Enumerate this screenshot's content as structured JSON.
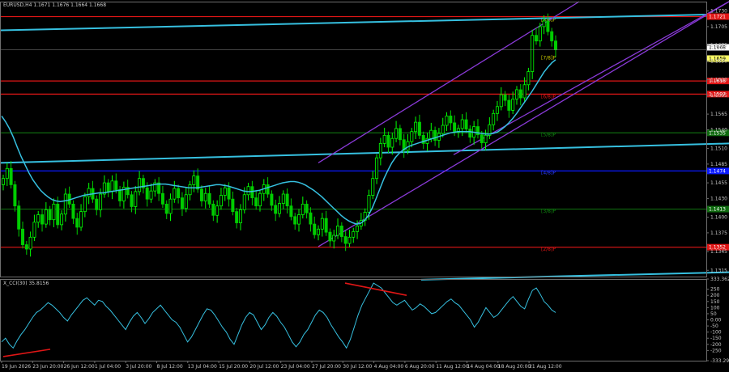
{
  "header": {
    "symbol_line": "EURUSD,H4  1.1671 1.1676 1.1664 1.1668",
    "indicator_line": "X_CCI(30) 35.8156"
  },
  "colors": {
    "background": "#000000",
    "frame": "#6f6f6f",
    "candle_up": "#00ff00",
    "candle_down": "#00cc00",
    "ma": "#36c0e0",
    "trendline": "#36c0e0",
    "channel": "#8a3ad8",
    "res_red": "#e01616",
    "sup_blue": "#0a1aff",
    "green_level": "#0f6a0f",
    "cci_line": "#36c0e0",
    "divergence": "#e01616"
  },
  "chart_data": [
    {
      "type": "candlestick",
      "panel": "price",
      "symbol": "EURUSD",
      "timeframe": "H4",
      "y_axis": {
        "range": [
          1.1305,
          1.1745
        ],
        "tick_labels": [
          "1.1730",
          "1.1705",
          "1.1675",
          "1.1650",
          "1.1620",
          "1.1595",
          "1.1565",
          "1.1540",
          "1.1510",
          "1.1485",
          "1.1455",
          "1.1430",
          "1.1400",
          "1.1375",
          "1.1345",
          "1.1315"
        ]
      },
      "x_axis": {
        "tick_labels": [
          "19 Jun 2026",
          "23 Jun 20:00",
          "26 Jun 12:00",
          "1 Jul 04:00",
          "3 Jul 20:00",
          "8 Jul 12:00",
          "13 Jul 04:00",
          "15 Jul 20:00",
          "20 Jul 12:00",
          "23 Jul 04:00",
          "27 Jul 20:00",
          "30 Jul 12:00",
          "4 Aug 04:00",
          "6 Aug 20:00",
          "11 Aug 12:00",
          "14 Aug 04:00",
          "18 Aug 20:00",
          "21 Aug 12:00"
        ]
      },
      "current_price": {
        "label": "1.1668",
        "value": 1.1668
      },
      "price_labels": [
        {
          "label": "1.1668",
          "value": 1.1668,
          "color": "#ffffff"
        },
        {
          "label": "1.1659",
          "value": 1.1659,
          "color": "#ffff66"
        }
      ],
      "horizontal_levels": [
        {
          "value": 1.1721,
          "label": "1.1721",
          "color": "#e01616"
        },
        {
          "value": 1.1618,
          "label": "1.1618",
          "color": "#e01616"
        },
        {
          "value": 1.1597,
          "label": "1.1597",
          "color": "#e01616"
        },
        {
          "value": 1.1535,
          "label": "1.1535",
          "color": "#0f6a0f"
        },
        {
          "value": 1.1474,
          "label": "1.1474",
          "color": "#0a1aff"
        },
        {
          "value": 1.1413,
          "label": "1.1413",
          "color": "#0f6a0f"
        },
        {
          "value": 1.1352,
          "label": "1.1352",
          "color": "#e01616"
        }
      ],
      "murray_labels": [
        {
          "text": "[8/8]P",
          "value": 1.1716,
          "color": "#c9c900"
        },
        {
          "text": "[7/8]P",
          "value": 1.1655,
          "color": "#c9c900"
        },
        {
          "text": "[6/8]P",
          "value": 1.1593,
          "color": "#e01616"
        },
        {
          "text": "[5/8]P",
          "value": 1.1532,
          "color": "#0f8a0f"
        },
        {
          "text": "[4/8]P",
          "value": 1.1471,
          "color": "#2a3aff"
        },
        {
          "text": "[3/8]P",
          "value": 1.141,
          "color": "#0f8a0f"
        },
        {
          "text": "[2/8]P",
          "value": 1.1349,
          "color": "#e01616"
        }
      ],
      "trendlines": [
        {
          "from": [
            0,
            1.1699
          ],
          "to": [
            900,
            1.1725
          ],
          "color": "#36c0e0"
        },
        {
          "from": [
            0,
            1.1487
          ],
          "to": [
            900,
            1.1518
          ],
          "color": "#36c0e0"
        },
        {
          "from": [
            520,
            1.13
          ],
          "to": [
            900,
            1.1312
          ],
          "color": "#36c0e0"
        }
      ],
      "channel": [
        {
          "from": [
            393,
            1.1487
          ],
          "to": [
            715,
            1.1745
          ],
          "color": "#8a3ad8"
        },
        {
          "from": [
            393,
            1.1353
          ],
          "to": [
            900,
            1.1745
          ],
          "color": "#8a3ad8"
        },
        {
          "from": [
            560,
            1.15
          ],
          "to": [
            900,
            1.1745
          ],
          "color": "#8a3ad8"
        }
      ],
      "ma_series": [
        1.1562,
        1.1553,
        1.1542,
        1.1528,
        1.1512,
        1.1497,
        1.1484,
        1.1471,
        1.146,
        1.1451,
        1.1443,
        1.1437,
        1.1432,
        1.1428,
        1.1426,
        1.1425,
        1.1426,
        1.1427,
        1.1429,
        1.1431,
        1.1433,
        1.1435,
        1.1436,
        1.1437,
        1.1438,
        1.1439,
        1.1439,
        1.144,
        1.1441,
        1.1442,
        1.1443,
        1.1444,
        1.1445,
        1.1446,
        1.1447,
        1.1448,
        1.1449,
        1.145,
        1.1451,
        1.1452,
        1.1453,
        1.1453,
        1.1453,
        1.1452,
        1.1451,
        1.145,
        1.1449,
        1.1448,
        1.1447,
        1.1447,
        1.1447,
        1.1448,
        1.1449,
        1.145,
        1.1451,
        1.1452,
        1.1452,
        1.1451,
        1.145,
        1.1448,
        1.1446,
        1.1444,
        1.1442,
        1.1441,
        1.1441,
        1.1442,
        1.1443,
        1.1445,
        1.1447,
        1.1449,
        1.1451,
        1.1453,
        1.1455,
        1.1456,
        1.1457,
        1.1457,
        1.1456,
        1.1454,
        1.1451,
        1.1447,
        1.1443,
        1.1438,
        1.1433,
        1.1427,
        1.1421,
        1.1415,
        1.1409,
        1.1403,
        1.1398,
        1.1394,
        1.1391,
        1.1389,
        1.139,
        1.1395,
        1.1403,
        1.1415,
        1.143,
        1.1446,
        1.1462,
        1.1475,
        1.1487,
        1.1496,
        1.1503,
        1.1508,
        1.1512,
        1.1515,
        1.1517,
        1.1519,
        1.1521,
        1.1523,
        1.1525,
        1.1527,
        1.1529,
        1.1531,
        1.1533,
        1.1535,
        1.1536,
        1.1537,
        1.1537,
        1.1537,
        1.1537,
        1.1536,
        1.1535,
        1.1534,
        1.1533,
        1.1533,
        1.1534,
        1.1536,
        1.154,
        1.1545,
        1.1551,
        1.1558,
        1.1566,
        1.1575,
        1.1584,
        1.1593,
        1.1602,
        1.1612,
        1.1622,
        1.1632,
        1.164,
        1.1647,
        1.1652
      ],
      "candle_closes": [
        1.1462,
        1.1478,
        1.1452,
        1.1418,
        1.1381,
        1.1356,
        1.1349,
        1.1368,
        1.1392,
        1.1404,
        1.1389,
        1.1412,
        1.1396,
        1.1421,
        1.1388,
        1.1405,
        1.1437,
        1.1421,
        1.1398,
        1.1384,
        1.1409,
        1.1433,
        1.1446,
        1.1429,
        1.1412,
        1.1437,
        1.1455,
        1.1441,
        1.1458,
        1.1444,
        1.1426,
        1.1448,
        1.1436,
        1.1417,
        1.1441,
        1.1462,
        1.1447,
        1.1429,
        1.1442,
        1.1455,
        1.1438,
        1.1421,
        1.1406,
        1.1429,
        1.1446,
        1.1431,
        1.1414,
        1.1436,
        1.1452,
        1.1466,
        1.1445,
        1.1426,
        1.1438,
        1.1421,
        1.1403,
        1.1418,
        1.1435,
        1.1447,
        1.1429,
        1.1409,
        1.1391,
        1.1412,
        1.1436,
        1.1449,
        1.1431,
        1.1418,
        1.1438,
        1.1452,
        1.1437,
        1.1419,
        1.1406,
        1.1422,
        1.1437,
        1.1418,
        1.1401,
        1.1389,
        1.1404,
        1.1421,
        1.1407,
        1.1389,
        1.1372,
        1.1381,
        1.1398,
        1.1376,
        1.1362,
        1.1371,
        1.1386,
        1.1369,
        1.1358,
        1.1368,
        1.1377,
        1.1386,
        1.1395,
        1.1408,
        1.1435,
        1.1462,
        1.1495,
        1.1518,
        1.1531,
        1.1512,
        1.1526,
        1.1542,
        1.1524,
        1.1507,
        1.1521,
        1.1537,
        1.1552,
        1.1531,
        1.1518,
        1.1526,
        1.1539,
        1.1523,
        1.1534,
        1.1547,
        1.1562,
        1.1551,
        1.1536,
        1.1542,
        1.1556,
        1.1541,
        1.1528,
        1.1545,
        1.1532,
        1.1519,
        1.1531,
        1.1548,
        1.1566,
        1.1577,
        1.1596,
        1.1587,
        1.1571,
        1.1589,
        1.1604,
        1.1591,
        1.1612,
        1.1633,
        1.1691,
        1.1682,
        1.1705,
        1.1714,
        1.1697,
        1.1682,
        1.1668
      ]
    },
    {
      "type": "line",
      "panel": "indicator",
      "name": "X_CCI(30)",
      "y_axis": {
        "range": [
          -333.2996,
          333.3623
        ],
        "tick_labels": [
          "333.3623",
          "250",
          "200",
          "150",
          "100",
          "50",
          "0.00",
          "-50",
          "-100",
          "-150",
          "-200",
          "-250",
          "-333.2996"
        ]
      },
      "values": [
        -180,
        -150,
        -200,
        -230,
        -170,
        -120,
        -80,
        -30,
        20,
        60,
        80,
        110,
        140,
        120,
        90,
        60,
        20,
        -10,
        40,
        80,
        120,
        160,
        180,
        150,
        120,
        160,
        150,
        110,
        80,
        40,
        0,
        -40,
        -80,
        -20,
        30,
        60,
        20,
        -30,
        10,
        60,
        90,
        120,
        80,
        40,
        0,
        -20,
        -60,
        -120,
        -180,
        -140,
        -80,
        -20,
        40,
        90,
        80,
        40,
        -10,
        -60,
        -100,
        -160,
        -200,
        -120,
        -40,
        20,
        60,
        40,
        -20,
        -80,
        -40,
        20,
        60,
        30,
        -20,
        -60,
        -120,
        -180,
        -220,
        -180,
        -120,
        -80,
        -20,
        40,
        80,
        60,
        20,
        -40,
        -90,
        -140,
        -180,
        -230,
        -160,
        -60,
        40,
        120,
        180,
        240,
        300,
        280,
        260,
        220,
        180,
        140,
        120,
        140,
        160,
        120,
        80,
        100,
        130,
        110,
        80,
        50,
        60,
        90,
        120,
        150,
        170,
        140,
        120,
        80,
        40,
        0,
        -60,
        -20,
        40,
        100,
        60,
        20,
        40,
        80,
        120,
        160,
        190,
        150,
        110,
        90,
        170,
        240,
        260,
        210,
        150,
        120,
        80,
        60
      ]
    }
  ]
}
